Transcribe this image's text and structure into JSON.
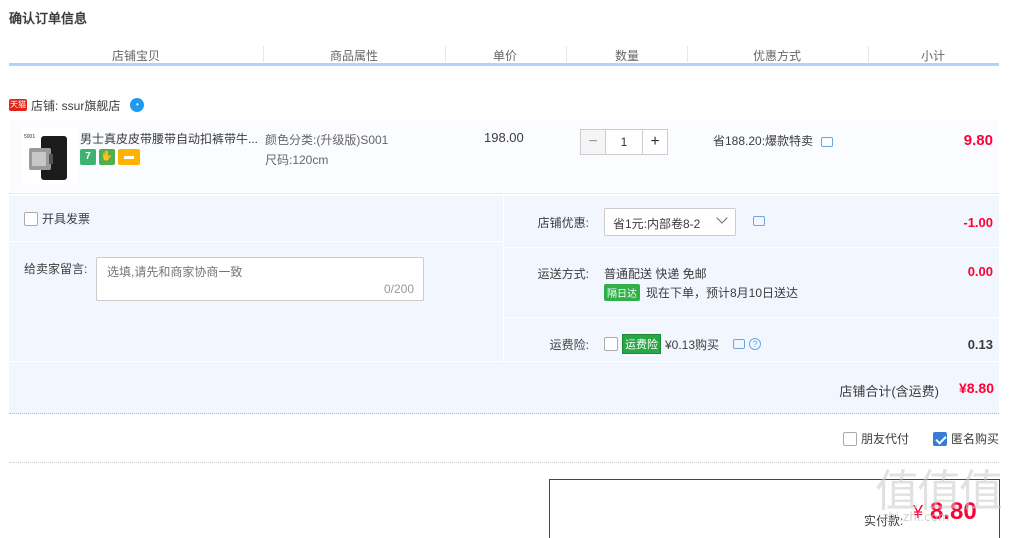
{
  "section_title": "确认订单信息",
  "columns": [
    "店铺宝贝",
    "商品属性",
    "单价",
    "数量",
    "优惠方式",
    "小计"
  ],
  "shop": {
    "badge": "天猫",
    "label": "店铺: ssur旗舰店"
  },
  "item": {
    "name": "男士真皮皮带腰带自动扣裤带牛...",
    "thumb_text": "5001",
    "attr_color": "颜色分类:(升级版)S001",
    "attr_size": "尺码:120cm",
    "price": "198.00",
    "quantity": "1",
    "promo": "省188.20:爆款特卖",
    "subtotal": "9.80"
  },
  "invoice": {
    "label": "开具发票"
  },
  "message": {
    "label": "给卖家留言:",
    "placeholder": "选填,请先和商家协商一致",
    "count": "0/200"
  },
  "shop_discount": {
    "label": "店铺优惠:",
    "selected": "省1元:内部卷8-2",
    "value": "-1.00"
  },
  "shipping": {
    "label": "运送方式:",
    "method": "普通配送 快递 免邮",
    "badge": "隔日达",
    "eta": "现在下单，预计8月10日送达",
    "value": "0.00"
  },
  "insurance": {
    "label": "运费险:",
    "badge": "运费险",
    "price": "¥0.13购买",
    "value": "0.13"
  },
  "shop_total": {
    "label": "店铺合计(含运费)",
    "value": "¥8.80"
  },
  "options": {
    "friend_pay": "朋友代付",
    "anonymous": "匿名购买"
  },
  "payment": {
    "label": "实付款:",
    "currency": "¥",
    "amount": "8.80"
  },
  "watermark": {
    "main": "值值值",
    "sub": "zhi.zhi.com"
  },
  "colors": {
    "accent_red": "#ff0036",
    "panel_bg": "#f2f7ff",
    "header_line": "#b2d1ff"
  }
}
